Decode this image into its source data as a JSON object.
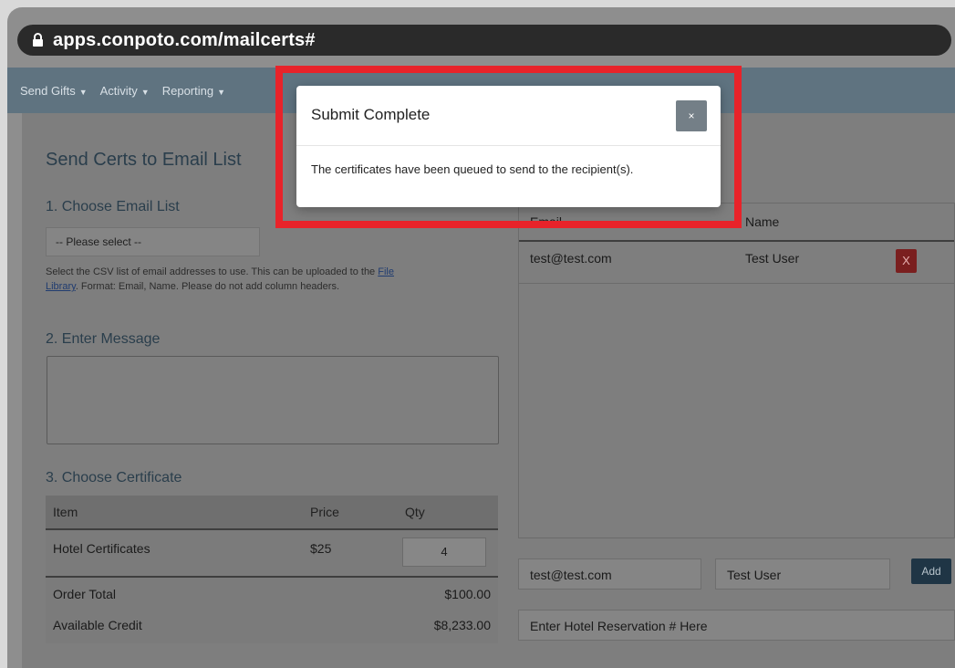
{
  "browser": {
    "url": "apps.conpoto.com/mailcerts#"
  },
  "nav": {
    "items": [
      "Send Gifts",
      "Activity",
      "Reporting"
    ],
    "caret": "▼"
  },
  "page": {
    "title": "Send Certs to Email List",
    "step1": "1. Choose Email List",
    "select_value": "-- Please select --",
    "help_pre": "Select the CSV list of email addresses to use. This can be uploaded to the ",
    "help_link_1": "File",
    "help_link_2": "Library",
    "help_post": ". Format: Email, Name. Please do not add column headers.",
    "step2": "2. Enter Message",
    "step3": "3. Choose Certificate"
  },
  "cert_table": {
    "headers": [
      "Item",
      "Price",
      "Qty"
    ],
    "row": {
      "item": "Hotel Certificates",
      "price": "$25",
      "qty": "4"
    },
    "order_total_label": "Order Total",
    "order_total": "$100.00",
    "credit_label": "Available Credit",
    "credit": "$8,233.00"
  },
  "email_table": {
    "headers": [
      "Email",
      "Name"
    ],
    "rows": [
      {
        "email": "test@test.com",
        "name": "Test User",
        "delete": "X"
      }
    ]
  },
  "add_form": {
    "email_value": "test@test.com",
    "name_value": "Test User",
    "add_label": "Add",
    "reservation_placeholder": "Enter Hotel Reservation # Here"
  },
  "modal": {
    "title": "Submit Complete",
    "close": "×",
    "body": "The certificates have been queued to send to the recipient(s)."
  },
  "colors": {
    "highlight": "#e8232a",
    "nav": "#5f7380",
    "delete": "#7a1f1f",
    "add": "#1f3545"
  }
}
